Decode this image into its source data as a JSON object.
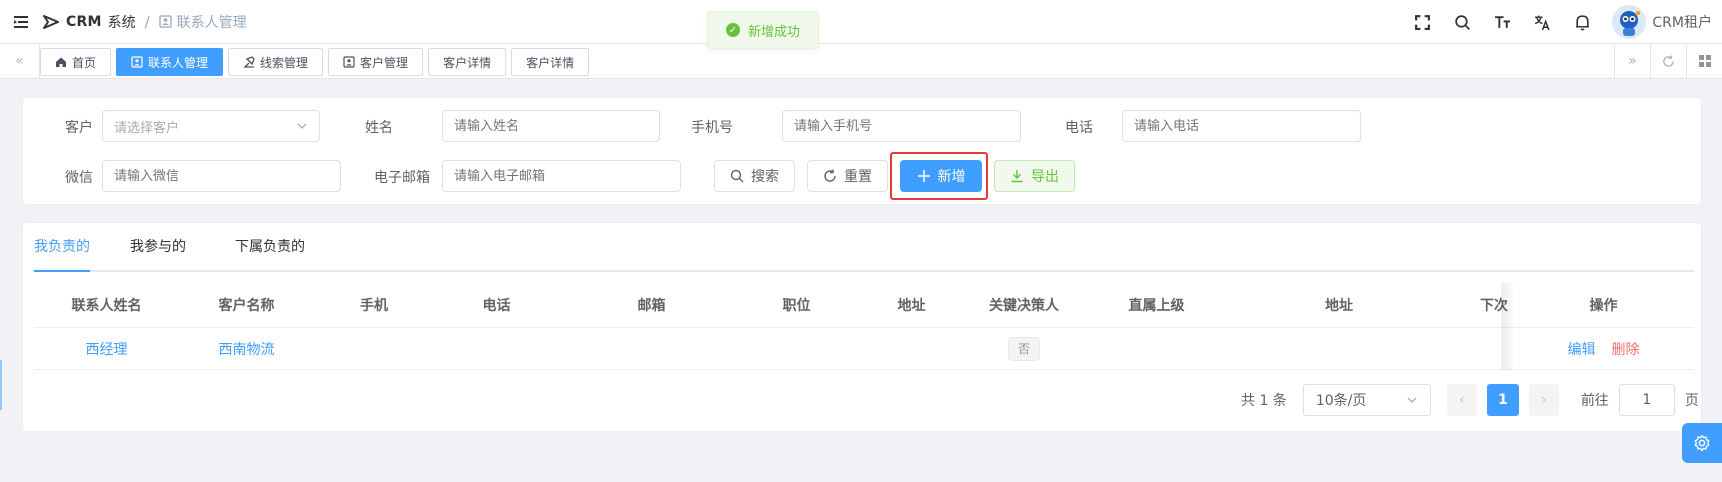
{
  "header": {
    "brand": "CRM",
    "brand_suffix": "系统",
    "breadcrumb_current": "联系人管理",
    "toast": "新增成功",
    "username": "CRM租户"
  },
  "tags": [
    {
      "label": "首页",
      "icon": "home-icon",
      "active": false
    },
    {
      "label": "联系人管理",
      "icon": "contact-icon",
      "active": true
    },
    {
      "label": "线索管理",
      "icon": "clue-icon",
      "active": false
    },
    {
      "label": "客户管理",
      "icon": "customer-icon",
      "active": false
    },
    {
      "label": "客户详情",
      "icon": "",
      "active": false
    },
    {
      "label": "客户详情",
      "icon": "",
      "active": false
    }
  ],
  "search": {
    "customer_label": "客户",
    "customer_placeholder": "请选择客户",
    "name_label": "姓名",
    "name_placeholder": "请输入姓名",
    "mobile_label": "手机号",
    "mobile_placeholder": "请输入手机号",
    "phone_label": "电话",
    "phone_placeholder": "请输入电话",
    "wechat_label": "微信",
    "wechat_placeholder": "请输入微信",
    "email_label": "电子邮箱",
    "email_placeholder": "请输入电子邮箱",
    "search_btn": "搜索",
    "reset_btn": "重置",
    "add_btn": "新增",
    "export_btn": "导出"
  },
  "tabs": [
    "我负责的",
    "我参与的",
    "下属负责的"
  ],
  "table": {
    "columns": [
      "联系人姓名",
      "客户名称",
      "手机",
      "电话",
      "邮箱",
      "职位",
      "地址",
      "关键决策人",
      "直属上级",
      "地址",
      "下次",
      "操作"
    ],
    "rows": [
      {
        "name": "西经理",
        "customer": "西南物流",
        "mobile": "",
        "phone": "",
        "email": "",
        "position": "",
        "address": "",
        "key_decision": "否",
        "superior": "",
        "address2": "",
        "edit": "编辑",
        "delete": "删除"
      }
    ]
  },
  "pagination": {
    "total": "共 1 条",
    "page_size": "10条/页",
    "current_page": "1",
    "goto_label": "前往",
    "goto_value": "1",
    "page_suffix": "页"
  },
  "colors": {
    "primary": "#409eff",
    "success": "#67c23a",
    "danger": "#f56c6c",
    "highlight": "#e53935"
  }
}
